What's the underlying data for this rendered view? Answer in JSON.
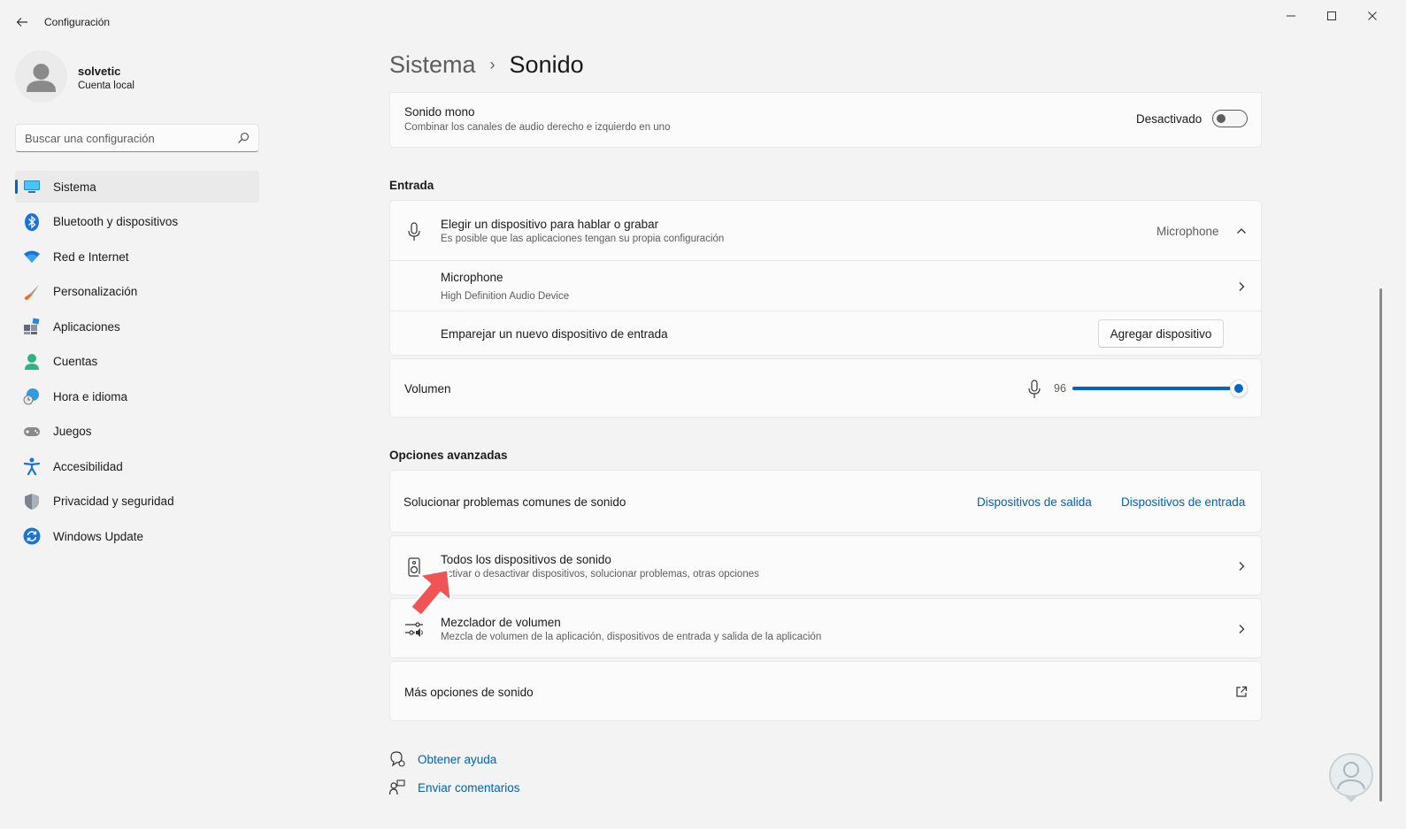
{
  "window": {
    "title": "Configuración"
  },
  "profile": {
    "name": "solvetic",
    "account": "Cuenta local"
  },
  "search": {
    "placeholder": "Buscar una configuración"
  },
  "nav": {
    "items": [
      {
        "label": "Sistema",
        "icon": "monitor-icon",
        "active": true
      },
      {
        "label": "Bluetooth y dispositivos",
        "icon": "bluetooth-icon"
      },
      {
        "label": "Red e Internet",
        "icon": "wifi-icon"
      },
      {
        "label": "Personalización",
        "icon": "brush-icon"
      },
      {
        "label": "Aplicaciones",
        "icon": "apps-icon"
      },
      {
        "label": "Cuentas",
        "icon": "person-icon"
      },
      {
        "label": "Hora e idioma",
        "icon": "globe-clock-icon"
      },
      {
        "label": "Juegos",
        "icon": "gamepad-icon"
      },
      {
        "label": "Accesibilidad",
        "icon": "accessibility-icon"
      },
      {
        "label": "Privacidad y seguridad",
        "icon": "shield-icon"
      },
      {
        "label": "Windows Update",
        "icon": "refresh-icon"
      }
    ]
  },
  "header": {
    "parent": "Sistema",
    "separator": "›",
    "current": "Sonido"
  },
  "mono": {
    "title": "Sonido mono",
    "subtitle": "Combinar los canales de audio derecho e izquierdo en uno",
    "state": "Desactivado",
    "enabled": false
  },
  "input": {
    "section": "Entrada",
    "choose_title": "Elegir un dispositivo para hablar o grabar",
    "choose_subtitle": "Es posible que las aplicaciones tengan su propia configuración",
    "choose_value": "Microphone",
    "device_name": "Microphone",
    "device_desc": "High Definition Audio Device",
    "pair_label": "Emparejar un nuevo dispositivo de entrada",
    "pair_button": "Agregar dispositivo",
    "volume_label": "Volumen",
    "volume_value": "96",
    "volume_level": 96
  },
  "advanced": {
    "section": "Opciones avanzadas",
    "troubleshoot_label": "Solucionar problemas comunes de sonido",
    "link_output": "Dispositivos de salida",
    "link_input": "Dispositivos de entrada",
    "all_devices_title": "Todos los dispositivos de sonido",
    "all_devices_subtitle": "Activar o desactivar dispositivos, solucionar problemas, otras opciones",
    "mixer_title": "Mezclador de volumen",
    "mixer_subtitle": "Mezcla de volumen de la aplicación, dispositivos de entrada y salida de la aplicación",
    "more_label": "Más opciones de sonido"
  },
  "footer": {
    "help": "Obtener ayuda",
    "feedback": "Enviar comentarios"
  },
  "colors": {
    "accent": "#0067c0",
    "annotation_arrow": "#f05454",
    "background": "#f3f3f3"
  }
}
